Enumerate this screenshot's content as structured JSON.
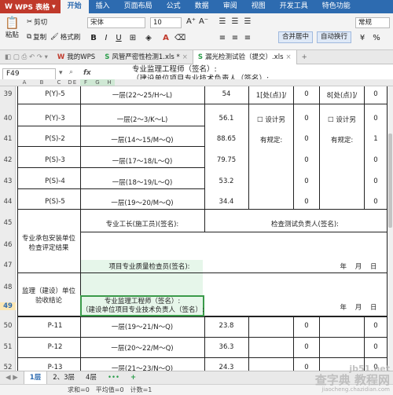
{
  "app": {
    "name": "WPS 表格",
    "caret": "▾"
  },
  "menu": [
    "开始",
    "插入",
    "页面布局",
    "公式",
    "数据",
    "审阅",
    "视图",
    "开发工具",
    "特色功能"
  ],
  "ribbon": {
    "paste": "粘贴",
    "cut": "剪切",
    "copy": "复制",
    "format_painter": "格式刷",
    "font_name": "宋体",
    "font_size": "10",
    "bold": "B",
    "italic": "I",
    "underline": "U",
    "font_color_icon": "A",
    "merge_center": "合并居中",
    "wrap_text": "自动换行",
    "number_format": "常规",
    "currency": "¥"
  },
  "tabs": [
    {
      "label": "我的WPS",
      "icon": "W"
    },
    {
      "label": "风管严密性检测1.xls *",
      "icon": "S"
    },
    {
      "label": "漏光检测试验（提交）.xls",
      "icon": "S"
    }
  ],
  "formula_bar": {
    "name_box": "F49",
    "fx": "fx",
    "content": "专业监理工程师（签名）:\n（建设单位项目专业技术负责人（签名）:"
  },
  "columns": [
    "A",
    "B",
    "C",
    "D",
    "E",
    "F",
    "G",
    "H"
  ],
  "rows": {
    "r39": {
      "num": "39",
      "code": "P(Y)-5",
      "floor": "一层(22～25/H～L)",
      "val": "54",
      "d1": "1[处(点)]/",
      "d2": "0",
      "d3": "8[处(点)]/",
      "d4": "0"
    },
    "r40": {
      "num": "40",
      "code": "P(Y)-3",
      "floor": "一层(2～3/K～L)",
      "val": "56.1",
      "d1": "☐ 设计另",
      "d2": "0",
      "d3": "☐ 设计另",
      "d4": "0"
    },
    "r41": {
      "num": "41",
      "code": "P(S)-2",
      "floor": "一层(14～15/M～Q)",
      "val": "88.65",
      "d1": "有规定:",
      "d2": "0",
      "d3": "有规定:",
      "d4": "1"
    },
    "r42": {
      "num": "42",
      "code": "P(S)-3",
      "floor": "一层(17～18/L～Q)",
      "val": "79.75",
      "d2": "0",
      "d4": "0"
    },
    "r43": {
      "num": "43",
      "code": "P(S)-4",
      "floor": "一层(18～19/L～Q)",
      "val": "53.2",
      "d2": "0",
      "d4": "0"
    },
    "r44": {
      "num": "44",
      "code": "P(S)-5",
      "floor": "一层(19～20/M～Q)",
      "val": "34.4",
      "d2": "0",
      "d4": "0"
    },
    "r45": {
      "num": "45",
      "left": "专业工长(施工员)(签名):",
      "right": "检查测试负责人(签名):"
    },
    "r46": {
      "num": "46",
      "section": "专业承包安装单位\n检查评定结果"
    },
    "r47": {
      "num": "47",
      "left": "项目专业质量检查员(签名):",
      "date": "年    月    日"
    },
    "r48": {
      "num": "48",
      "section": "监理（建设）单位\n验收结论"
    },
    "r49": {
      "num": "49",
      "left": "专业监理工程师（签名）:\n（建设单位项目专业技术负责人（签名）:",
      "date": "年    月    日"
    },
    "r50": {
      "num": "50",
      "code": "P-11",
      "floor": "一层(19～21/N～Q)",
      "val": "23.8",
      "d2": "0",
      "d4": "0"
    },
    "r51": {
      "num": "51",
      "code": "P-12",
      "floor": "一层(20～22/M～Q)",
      "val": "36.3",
      "d2": "0",
      "d4": "0"
    },
    "r52": {
      "num": "52",
      "code": "P-13",
      "floor": "一层(21～23/N～Q)",
      "val": "24.3",
      "d2": "0",
      "d4": "0"
    }
  },
  "sheets": [
    "1层",
    "2、3层",
    "4层",
    "+"
  ],
  "status": {
    "sum": "求和=0",
    "avg": "平均值=0",
    "count": "计数=1"
  },
  "watermark": {
    "line1": "查字典 教程网",
    "line2": "jiaocheng.chazidian.com",
    "site": "jb51.net"
  },
  "colors": {
    "menubar": "#2d6bb0",
    "app_button": "#c0392b",
    "selection": "#3a9a4a",
    "green_band": "#e6f6ea"
  }
}
